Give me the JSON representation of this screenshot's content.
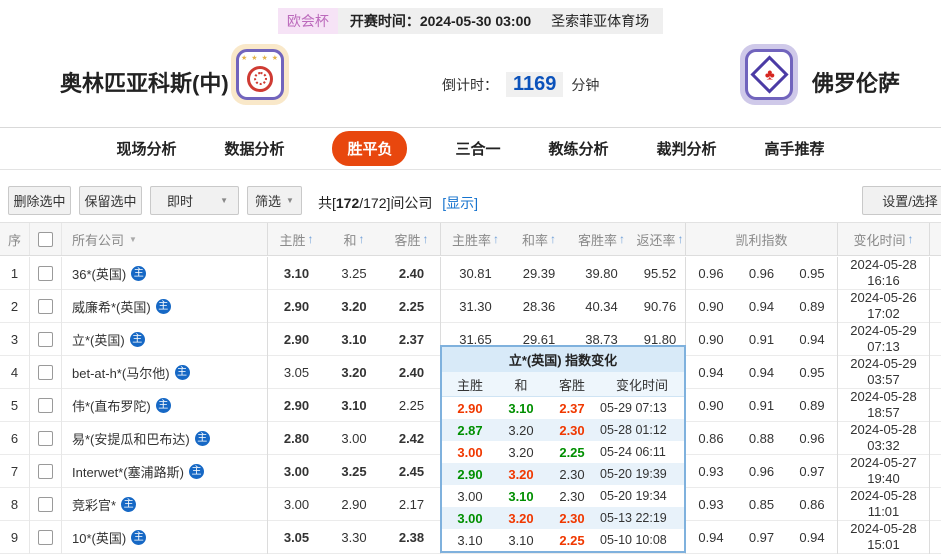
{
  "top_bar": {
    "league": "欧会杯",
    "kickoff_label": "开赛时间：",
    "kickoff_time": "2024-05-30 03:00",
    "venue": "圣索菲亚体育场"
  },
  "match": {
    "home_team": "奥林匹亚科斯(中)",
    "away_team": "佛罗伦萨",
    "countdown_label": "倒计时：",
    "countdown_value": "1169",
    "countdown_unit": "分钟"
  },
  "icons": {
    "logo_stars": "★ ★ ★ ★",
    "fleur": "♣",
    "caret_down": "▼",
    "sort_arrow": "↑",
    "main_icon": "主"
  },
  "nav": {
    "tabs": [
      "现场分析",
      "数据分析",
      "胜平负",
      "三合一",
      "教练分析",
      "裁判分析",
      "高手推荐"
    ],
    "active": "胜平负"
  },
  "toolbar": {
    "delete_label": "删除选中",
    "keep_label": "保留选中",
    "mode_label": "即时",
    "filter_label": "筛选",
    "count_prefix": "共[",
    "count_bold": "172",
    "count_suffix": "/172]间公司",
    "show_link": "[显示]",
    "settings_label": "设置/选择"
  },
  "table": {
    "headers": {
      "no": "序",
      "company": "所有公司",
      "home": "主胜",
      "draw": "和",
      "away": "客胜",
      "home_rate": "主胜率",
      "draw_rate": "和率",
      "away_rate": "客胜率",
      "return_rate": "返还率",
      "kelly": "凯利指数",
      "time": "变化时间"
    },
    "rows": [
      {
        "no": "1",
        "company": "36*(英国)",
        "home": "3.10",
        "home_c": "g",
        "draw": "3.25",
        "draw_c": "k",
        "away": "2.40",
        "away_c": "r",
        "home_rate": "30.81",
        "draw_rate": "29.39",
        "away_rate": "39.80",
        "return_rate": "95.52",
        "kelly1": "0.96",
        "kelly2": "0.96",
        "kelly3": "0.95",
        "date": "2024-05-28",
        "time": "16:16"
      },
      {
        "no": "2",
        "company": "威廉希*(英国)",
        "home": "2.90",
        "home_c": "g",
        "draw": "3.20",
        "draw_c": "g",
        "away": "2.25",
        "away_c": "r",
        "home_rate": "31.30",
        "draw_rate": "28.36",
        "away_rate": "40.34",
        "return_rate": "90.76",
        "kelly1": "0.90",
        "kelly2": "0.94",
        "kelly3": "0.89",
        "date": "2024-05-26",
        "time": "17:02"
      },
      {
        "no": "3",
        "company": "立*(英国)",
        "home": "2.90",
        "home_c": "g",
        "draw": "3.10",
        "draw_c": "g",
        "away": "2.37",
        "away_c": "r",
        "home_rate": "31.65",
        "draw_rate": "29.61",
        "away_rate": "38.73",
        "return_rate": "91.80",
        "kelly1": "0.90",
        "kelly2": "0.91",
        "kelly3": "0.94",
        "date": "2024-05-29",
        "time": "07:13"
      },
      {
        "no": "4",
        "company": "bet-at-h*(马尔他)",
        "home": "3.05",
        "home_c": "k",
        "draw": "3.20",
        "draw_c": "g",
        "away": "2.40",
        "away_c": "r",
        "home_rate": "",
        "draw_rate": "",
        "away_rate": "",
        "return_rate": "",
        "kelly1": "0.94",
        "kelly2": "0.94",
        "kelly3": "0.95",
        "date": "2024-05-29",
        "time": "03:57"
      },
      {
        "no": "5",
        "company": "伟*(直布罗陀)",
        "home": "2.90",
        "home_c": "g",
        "draw": "3.10",
        "draw_c": "r",
        "away": "2.25",
        "away_c": "k",
        "home_rate": "",
        "draw_rate": "",
        "away_rate": "",
        "return_rate": "",
        "kelly1": "0.90",
        "kelly2": "0.91",
        "kelly3": "0.89",
        "date": "2024-05-28",
        "time": "18:57"
      },
      {
        "no": "6",
        "company": "易*(安提瓜和巴布达)",
        "home": "2.80",
        "home_c": "g",
        "draw": "3.00",
        "draw_c": "k",
        "away": "2.42",
        "away_c": "r",
        "home_rate": "",
        "draw_rate": "",
        "away_rate": "",
        "return_rate": "",
        "kelly1": "0.86",
        "kelly2": "0.88",
        "kelly3": "0.96",
        "date": "2024-05-28",
        "time": "03:32"
      },
      {
        "no": "7",
        "company": "Interwet*(塞浦路斯)",
        "home": "3.00",
        "home_c": "g",
        "draw": "3.25",
        "draw_c": "g",
        "away": "2.45",
        "away_c": "r",
        "home_rate": "",
        "draw_rate": "",
        "away_rate": "",
        "return_rate": "",
        "kelly1": "0.93",
        "kelly2": "0.96",
        "kelly3": "0.97",
        "date": "2024-05-27",
        "time": "19:40"
      },
      {
        "no": "8",
        "company": "竞彩官*",
        "home": "3.00",
        "home_c": "k",
        "draw": "2.90",
        "draw_c": "k",
        "away": "2.17",
        "away_c": "k",
        "home_rate": "",
        "draw_rate": "",
        "away_rate": "",
        "return_rate": "",
        "kelly1": "0.93",
        "kelly2": "0.85",
        "kelly3": "0.86",
        "date": "2024-05-28",
        "time": "11:01"
      },
      {
        "no": "9",
        "company": "10*(英国)",
        "home": "3.05",
        "home_c": "g",
        "draw": "3.30",
        "draw_c": "k",
        "away": "2.38",
        "away_c": "r",
        "home_rate": "",
        "draw_rate": "",
        "away_rate": "",
        "return_rate": "",
        "kelly1": "0.94",
        "kelly2": "0.97",
        "kelly3": "0.94",
        "date": "2024-05-28",
        "time": "15:01"
      }
    ]
  },
  "popup": {
    "title": "立*(英国) 指数变化",
    "headers": {
      "home": "主胜",
      "draw": "和",
      "away": "客胜",
      "time": "变化时间"
    },
    "rows": [
      {
        "home": "2.90",
        "home_c": "r",
        "draw": "3.10",
        "draw_c": "g",
        "away": "2.37",
        "away_c": "r",
        "time": "05-29 07:13"
      },
      {
        "home": "2.87",
        "home_c": "g",
        "draw": "3.20",
        "draw_c": "k",
        "away": "2.30",
        "away_c": "r",
        "time": "05-28 01:12"
      },
      {
        "home": "3.00",
        "home_c": "r",
        "draw": "3.20",
        "draw_c": "k",
        "away": "2.25",
        "away_c": "g",
        "time": "05-24 06:11"
      },
      {
        "home": "2.90",
        "home_c": "g",
        "draw": "3.20",
        "draw_c": "r",
        "away": "2.30",
        "away_c": "k",
        "time": "05-20 19:39"
      },
      {
        "home": "3.00",
        "home_c": "k",
        "draw": "3.10",
        "draw_c": "g",
        "away": "2.30",
        "away_c": "k",
        "time": "05-20 19:34"
      },
      {
        "home": "3.00",
        "home_c": "g",
        "draw": "3.20",
        "draw_c": "r",
        "away": "2.30",
        "away_c": "r",
        "time": "05-13 22:19"
      },
      {
        "home": "3.10",
        "home_c": "k",
        "draw": "3.10",
        "draw_c": "k",
        "away": "2.25",
        "away_c": "r",
        "time": "05-10 10:08"
      }
    ]
  },
  "colors": {
    "odds_up_red": "#f03800",
    "odds_down_green": "#008f00",
    "accent_blue": "#0b52bb",
    "nav_active_bg": "#e8470e",
    "league_purple": "#bc6abc",
    "popup_border": "#7fb1dd"
  }
}
